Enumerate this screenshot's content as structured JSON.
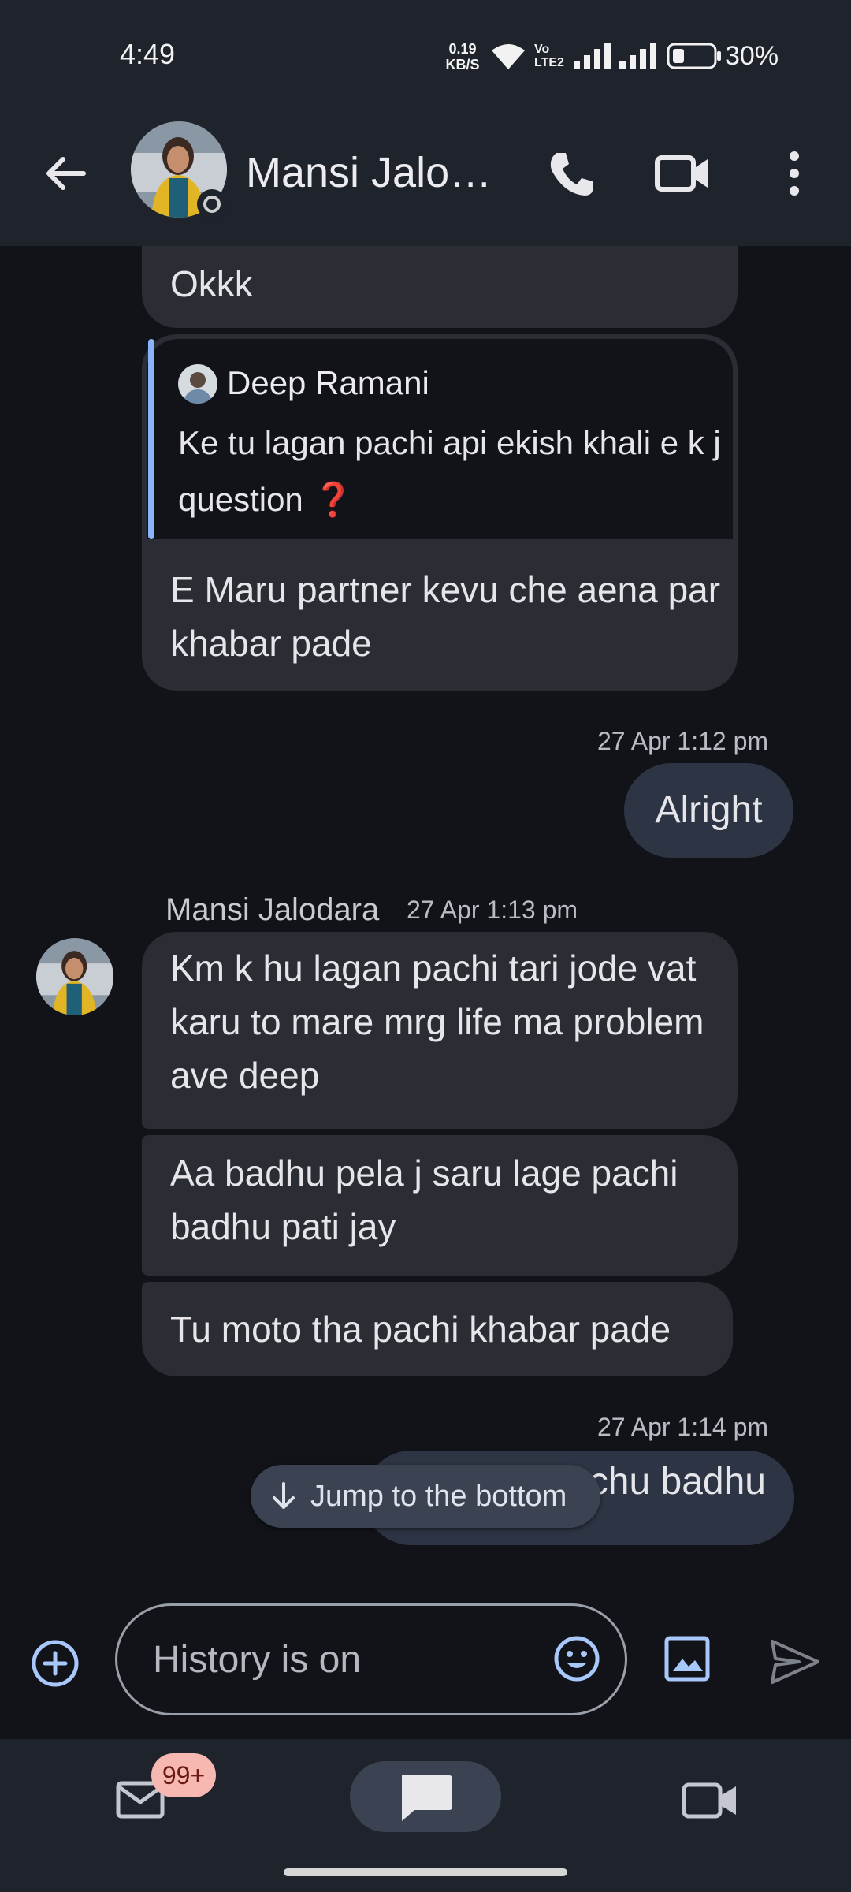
{
  "status_bar": {
    "time": "4:49",
    "net_speed_value": "0.19",
    "net_speed_unit": "KB/S",
    "volte_label": "Vo LTE2",
    "battery_percent": "30%"
  },
  "header": {
    "contact_name": "Mansi Jalo…"
  },
  "messages": {
    "okkk": "Okkk",
    "quote_author": "Deep Ramani",
    "quote_text": "Ke tu lagan pachi api ekish khali e k j question ❓",
    "quote_reply": "E Maru partner kevu che aena par khabar pade",
    "ts_1": "27 Apr 1:12 pm",
    "alright": "Alright",
    "sender_name": "Mansi Jalodara",
    "ts_2": "27 Apr 1:13 pm",
    "km": "Km k hu lagan pachi tari jode vat karu to mare mrg life ma problem ave deep",
    "aa": "Aa badhu pela j saru lage pachi badhu pati jay",
    "tu": "Tu moto tha pachi khabar pade",
    "ts_3": "27 Apr 1:14 pm",
    "partial": "chu badhu"
  },
  "jump_button": {
    "label": "Jump to the bottom"
  },
  "compose": {
    "placeholder": "History is on"
  },
  "bottom_nav": {
    "mail_badge": "99+"
  },
  "icons": {
    "back": "arrow-back-icon",
    "call": "phone-icon",
    "video": "video-camera-icon",
    "more": "more-vert-icon",
    "add": "add-circle-icon",
    "emoji": "emoji-icon",
    "image": "image-icon",
    "send": "send-icon",
    "mail": "mail-icon",
    "chat": "chat-icon",
    "meet": "video-icon"
  },
  "colors": {
    "background": "#111318",
    "bar": "#1f232b",
    "incoming_bubble": "#2a2d34",
    "outgoing_bubble": "#2d3545",
    "accent": "#8ab4f8",
    "badge": "#f6b8b0"
  }
}
